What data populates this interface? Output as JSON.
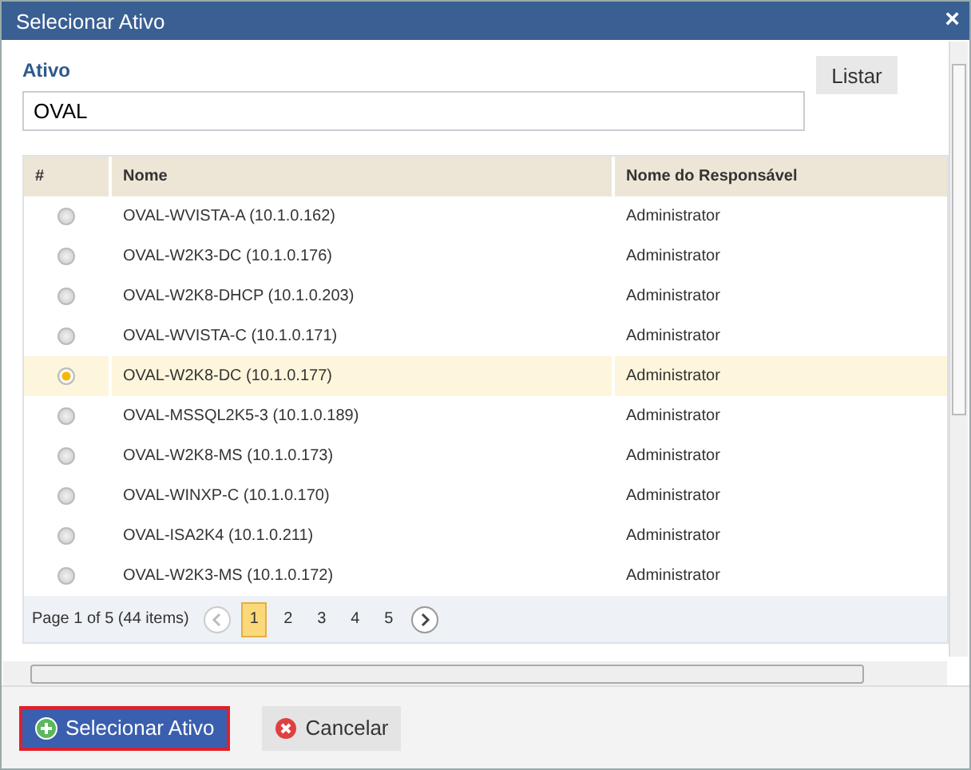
{
  "window": {
    "title": "Selecionar Ativo",
    "close": "×"
  },
  "field": {
    "label": "Ativo",
    "value": "OVAL"
  },
  "list_button": "Listar",
  "table": {
    "columns": [
      "#",
      "Nome",
      "Nome do Responsável"
    ],
    "rows": [
      {
        "name": "OVAL-WVISTA-A (10.1.0.162)",
        "owner": "Administrator",
        "selected": false
      },
      {
        "name": "OVAL-W2K3-DC (10.1.0.176)",
        "owner": "Administrator",
        "selected": false
      },
      {
        "name": "OVAL-W2K8-DHCP (10.1.0.203)",
        "owner": "Administrator",
        "selected": false
      },
      {
        "name": "OVAL-WVISTA-C (10.1.0.171)",
        "owner": "Administrator",
        "selected": false
      },
      {
        "name": "OVAL-W2K8-DC (10.1.0.177)",
        "owner": "Administrator",
        "selected": true
      },
      {
        "name": "OVAL-MSSQL2K5-3 (10.1.0.189)",
        "owner": "Administrator",
        "selected": false
      },
      {
        "name": "OVAL-W2K8-MS (10.1.0.173)",
        "owner": "Administrator",
        "selected": false
      },
      {
        "name": "OVAL-WINXP-C (10.1.0.170)",
        "owner": "Administrator",
        "selected": false
      },
      {
        "name": "OVAL-ISA2K4 (10.1.0.211)",
        "owner": "Administrator",
        "selected": false
      },
      {
        "name": "OVAL-W2K3-MS (10.1.0.172)",
        "owner": "Administrator",
        "selected": false
      }
    ]
  },
  "pager": {
    "info": "Page 1 of 5 (44 items)",
    "pages": [
      {
        "label": "1",
        "selected": true
      },
      {
        "label": "2",
        "selected": false
      },
      {
        "label": "3",
        "selected": false
      },
      {
        "label": "4",
        "selected": false
      },
      {
        "label": "5",
        "selected": false
      }
    ]
  },
  "buttons": [
    {
      "kind": "confirm",
      "label": "Selecionar Ativo"
    },
    {
      "kind": "cancel",
      "label": "Cancelar"
    }
  ]
}
